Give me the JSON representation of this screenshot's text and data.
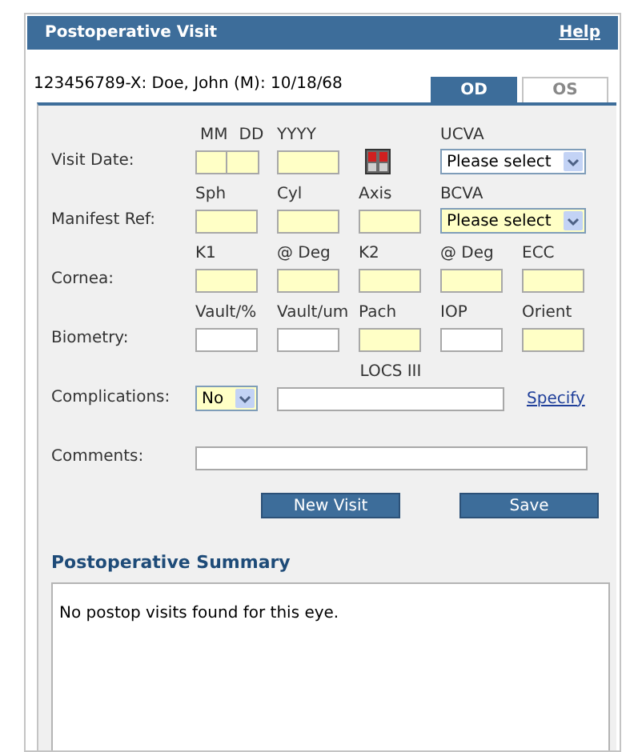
{
  "header": {
    "title": "Postoperative Visit",
    "help_link": "Help"
  },
  "patient": "123456789-X: Doe, John (M): 10/18/68",
  "tabs": [
    {
      "label": "OD",
      "selected": true
    },
    {
      "label": "OS",
      "selected": false
    }
  ],
  "rows": [
    {
      "label": "Visit Date:",
      "fields": [
        {
          "kind": "date_parts",
          "parts": [
            {
              "header": "MM",
              "required": true
            },
            {
              "header": "DD",
              "required": true
            }
          ]
        },
        {
          "kind": "input",
          "header": "YYYY",
          "required": true
        },
        {
          "kind": "calendar"
        },
        {
          "kind": "select",
          "header": "UCVA",
          "value": "Please select",
          "required": false
        }
      ]
    },
    {
      "label": "Manifest Ref:",
      "fields": [
        {
          "kind": "input",
          "header": "Sph",
          "required": true
        },
        {
          "kind": "input",
          "header": "Cyl",
          "required": true
        },
        {
          "kind": "input",
          "header": "Axis",
          "required": true
        },
        {
          "kind": "select",
          "header": "BCVA",
          "value": "Please select",
          "required": true
        }
      ]
    },
    {
      "label": "Cornea:",
      "fields": [
        {
          "kind": "input",
          "header": "K1",
          "required": true
        },
        {
          "kind": "input",
          "header": "@ Deg",
          "required": true
        },
        {
          "kind": "input",
          "header": "K2",
          "required": true
        },
        {
          "kind": "input",
          "header": "@ Deg",
          "required": true
        },
        {
          "kind": "input",
          "header": "ECC",
          "required": true
        }
      ]
    },
    {
      "label": "Biometry:",
      "fields": [
        {
          "kind": "input",
          "header": "Vault/%",
          "required": false
        },
        {
          "kind": "input",
          "header": "Vault/um",
          "required": false
        },
        {
          "kind": "input",
          "header": "Pach",
          "required": true
        },
        {
          "kind": "input",
          "header": "IOP",
          "required": false
        },
        {
          "kind": "input",
          "header": "Orient",
          "required": true
        }
      ]
    },
    {
      "label": "Complications:",
      "fields": [
        {
          "kind": "small_select",
          "value": "No",
          "required": true
        },
        {
          "kind": "long_input",
          "header": "LOCS III",
          "required": false
        },
        {
          "kind": "link",
          "label": "Specify"
        }
      ]
    },
    {
      "label": "Comments:",
      "fields": [
        {
          "kind": "comment_input",
          "required": false
        }
      ]
    }
  ],
  "buttons": [
    "New Visit",
    "Save"
  ],
  "summary": {
    "title": "Postoperative Summary",
    "text": "No postop visits found for this eye."
  }
}
